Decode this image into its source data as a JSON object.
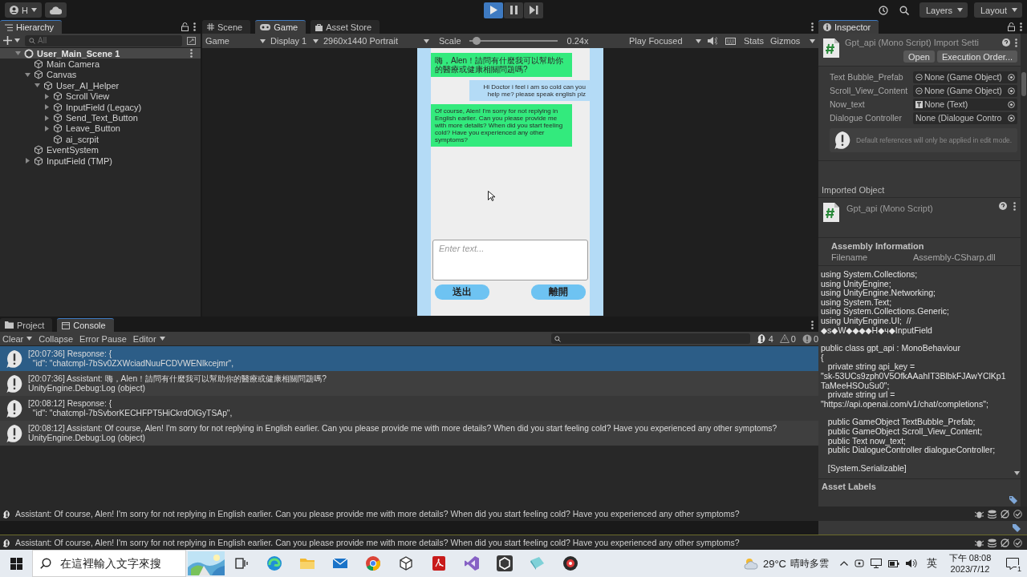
{
  "toolbar": {
    "account": "H",
    "play_buttons": [
      {
        "kind": "play",
        "selected": true
      },
      {
        "kind": "pause",
        "selected": false
      },
      {
        "kind": "step",
        "selected": false
      }
    ],
    "layers": "Layers",
    "layout": "Layout"
  },
  "hierarchy": {
    "tab": "Hierarchy",
    "placeholder": "All",
    "items": [
      {
        "label": "User_Main_Scene 1",
        "kind": "scene",
        "selected": true,
        "expanded": true,
        "children": [
          {
            "label": "Main Camera",
            "kind": "object",
            "selected": false
          },
          {
            "label": "Canvas",
            "kind": "object",
            "selected": false,
            "expanded": true,
            "children": [
              {
                "label": "User_AI_Helper",
                "kind": "object",
                "selected": false,
                "expanded": true,
                "children": [
                  {
                    "label": "Scroll View",
                    "kind": "object",
                    "selected": false,
                    "expanded": false
                  },
                  {
                    "label": "InputField (Legacy)",
                    "kind": "object",
                    "selected": false,
                    "expanded": false
                  },
                  {
                    "label": "Send_Text_Button",
                    "kind": "object",
                    "selected": false,
                    "expanded": false
                  },
                  {
                    "label": "Leave_Button",
                    "kind": "object",
                    "selected": false,
                    "expanded": false
                  },
                  {
                    "label": "ai_scrpit",
                    "kind": "object",
                    "selected": false
                  }
                ]
              }
            ]
          },
          {
            "label": "EventSystem",
            "kind": "object",
            "selected": false
          },
          {
            "label": "InputField (TMP)",
            "kind": "object",
            "selected": false,
            "expanded": false
          }
        ]
      }
    ]
  },
  "scene_tabs": [
    {
      "label": "Scene",
      "kind": "scene",
      "selected": false
    },
    {
      "label": "Game",
      "kind": "game",
      "selected": true
    },
    {
      "label": "Asset Store",
      "kind": "store",
      "selected": false
    }
  ],
  "game_toolbar": {
    "left_dropdowns": [
      "Game",
      "Display 1",
      "2960x1440 Portrait"
    ],
    "scale_label": "Scale",
    "scale": {
      "level": 0.05
    },
    "scale_value": "0.24x",
    "play_mode": "Play Focused",
    "stats": "Stats",
    "gizmos": "Gizmos"
  },
  "phone": {
    "messages": [
      {
        "kind": "assistant",
        "text": "嗨，Alen！請問有什麼我可以幫助你的醫療或健康相關問題嗎?"
      },
      {
        "kind": "user",
        "text": "Hi Doctor i feel i am so cold can you help me? please speak english plz"
      },
      {
        "kind": "assistant",
        "text": "Of course, Alen! I'm sorry for not replying in English earlier. Can you please provide me with more details? When did you start feeling cold? Have you experienced any other symptoms?"
      }
    ],
    "input_placeholder": "Enter text...",
    "buttons": [
      "送出",
      "離開"
    ]
  },
  "inspector": {
    "tab": "Inspector",
    "title": "Gpt_api (Mono Script) Import Setti",
    "buttons": [
      "Open",
      "Execution Order..."
    ],
    "fields": [
      {
        "label": "Text Bubble_Prefab",
        "value": "None (Game Object)",
        "kind": "gameobject"
      },
      {
        "label": "Scroll_View_Content",
        "value": "None (Game Object)",
        "kind": "gameobject"
      },
      {
        "label": "Now_text",
        "value": "None (Text)",
        "kind": "text"
      },
      {
        "label": "Dialogue Controller",
        "value": "None (Dialogue Contro",
        "kind": "plain"
      }
    ],
    "help": "Default references will only be applied in edit mode.",
    "imported_title": "Imported Object",
    "imported_name": "Gpt_api (Mono Script)",
    "assembly_title": "Assembly Information",
    "filename_label": "Filename",
    "filename": "Assembly-CSharp.dll",
    "code_blocks": [
      [
        "using System.Collections;",
        "using UnityEngine;",
        "using UnityEngine.Networking;",
        "using System.Text;",
        "using System.Collections.Generic;",
        "using UnityEngine.UI;  //",
        "◆s◆W◆◆◆◆H◆ч◆InputField"
      ],
      [
        "public class gpt_api : MonoBehaviour",
        "{",
        "   private string api_key =",
        "\"sk-53UCs9zph0V5OfkAAahIT3BlbkFJAwYClKp1",
        "TaMeeHSOuSu0\";",
        "   private string url =",
        "\"https://api.openai.com/v1/chat/completions\";"
      ],
      [
        "   public GameObject TextBubble_Prefab;",
        "   public GameObject Scroll_View_Content;",
        "   public Text now_text;",
        "   public DialogueController dialogueController;"
      ],
      [
        "   [System.Serializable]"
      ]
    ],
    "labels_title": "Asset Labels"
  },
  "console": {
    "tabs": [
      {
        "label": "Project",
        "kind": "folder",
        "selected": false
      },
      {
        "label": "Console",
        "kind": "console",
        "selected": true
      }
    ],
    "toolbar": [
      {
        "label": "Clear",
        "dropdown": true
      },
      {
        "label": "Collapse",
        "dropdown": false
      },
      {
        "label": "Error Pause",
        "dropdown": false
      },
      {
        "label": "Editor",
        "dropdown": true
      }
    ],
    "counts": [
      {
        "kind": "info",
        "count": "4"
      },
      {
        "kind": "warning",
        "count": "0"
      },
      {
        "kind": "error",
        "count": "0"
      }
    ],
    "entries": [
      {
        "selected": true,
        "lines": [
          "[20:07:36] Response: {",
          "  \"id\": \"chatcmpl-7bSv0ZXWciadNuuFCDVWENlkcejmr\","
        ]
      },
      {
        "selected": false,
        "lines": [
          "[20:07:36] Assistant: 嗨，Alen！請問有什麼我可以幫助你的醫療或健康相關問題嗎?",
          "UnityEngine.Debug:Log (object)"
        ]
      },
      {
        "selected": false,
        "lines": [
          "[20:08:12] Response: {",
          "  \"id\": \"chatcmpl-7bSvborKECHFPT5HiCkrdOlGyTSAp\","
        ]
      },
      {
        "selected": false,
        "lines": [
          "[20:08:12] Assistant: Of course, Alen! I'm sorry for not replying in English earlier. Can you please provide me with more details? When did you start feeling cold? Have you experienced any other symptoms?",
          "UnityEngine.Debug:Log (object)"
        ]
      }
    ]
  },
  "status_lines": [
    "Assistant: Of course, Alen! I'm sorry for not replying in English earlier. Can you please provide me with more details? When did you start feeling cold? Have you experienced any other symptoms?",
    "Assistant: Of course, Alen! I'm sorry for not replying in English earlier. Can you please provide me with more details? When did you start feeling cold? Have you experienced any other symptoms?"
  ],
  "taskbar": {
    "search_placeholder": "在這裡輸入文字來搜",
    "apps": [
      {
        "kind": "edge"
      },
      {
        "kind": "folder"
      },
      {
        "kind": "mail"
      },
      {
        "kind": "chrome"
      },
      {
        "kind": "cube"
      },
      {
        "kind": "pdf"
      },
      {
        "kind": "vs"
      },
      {
        "kind": "unity"
      },
      {
        "kind": "tile"
      },
      {
        "kind": "record"
      }
    ],
    "temperature": "29°C",
    "weather": "晴時多雲",
    "ime": "英",
    "time": "下午 08:08",
    "date": "2023/7/12",
    "notifications": "1"
  }
}
